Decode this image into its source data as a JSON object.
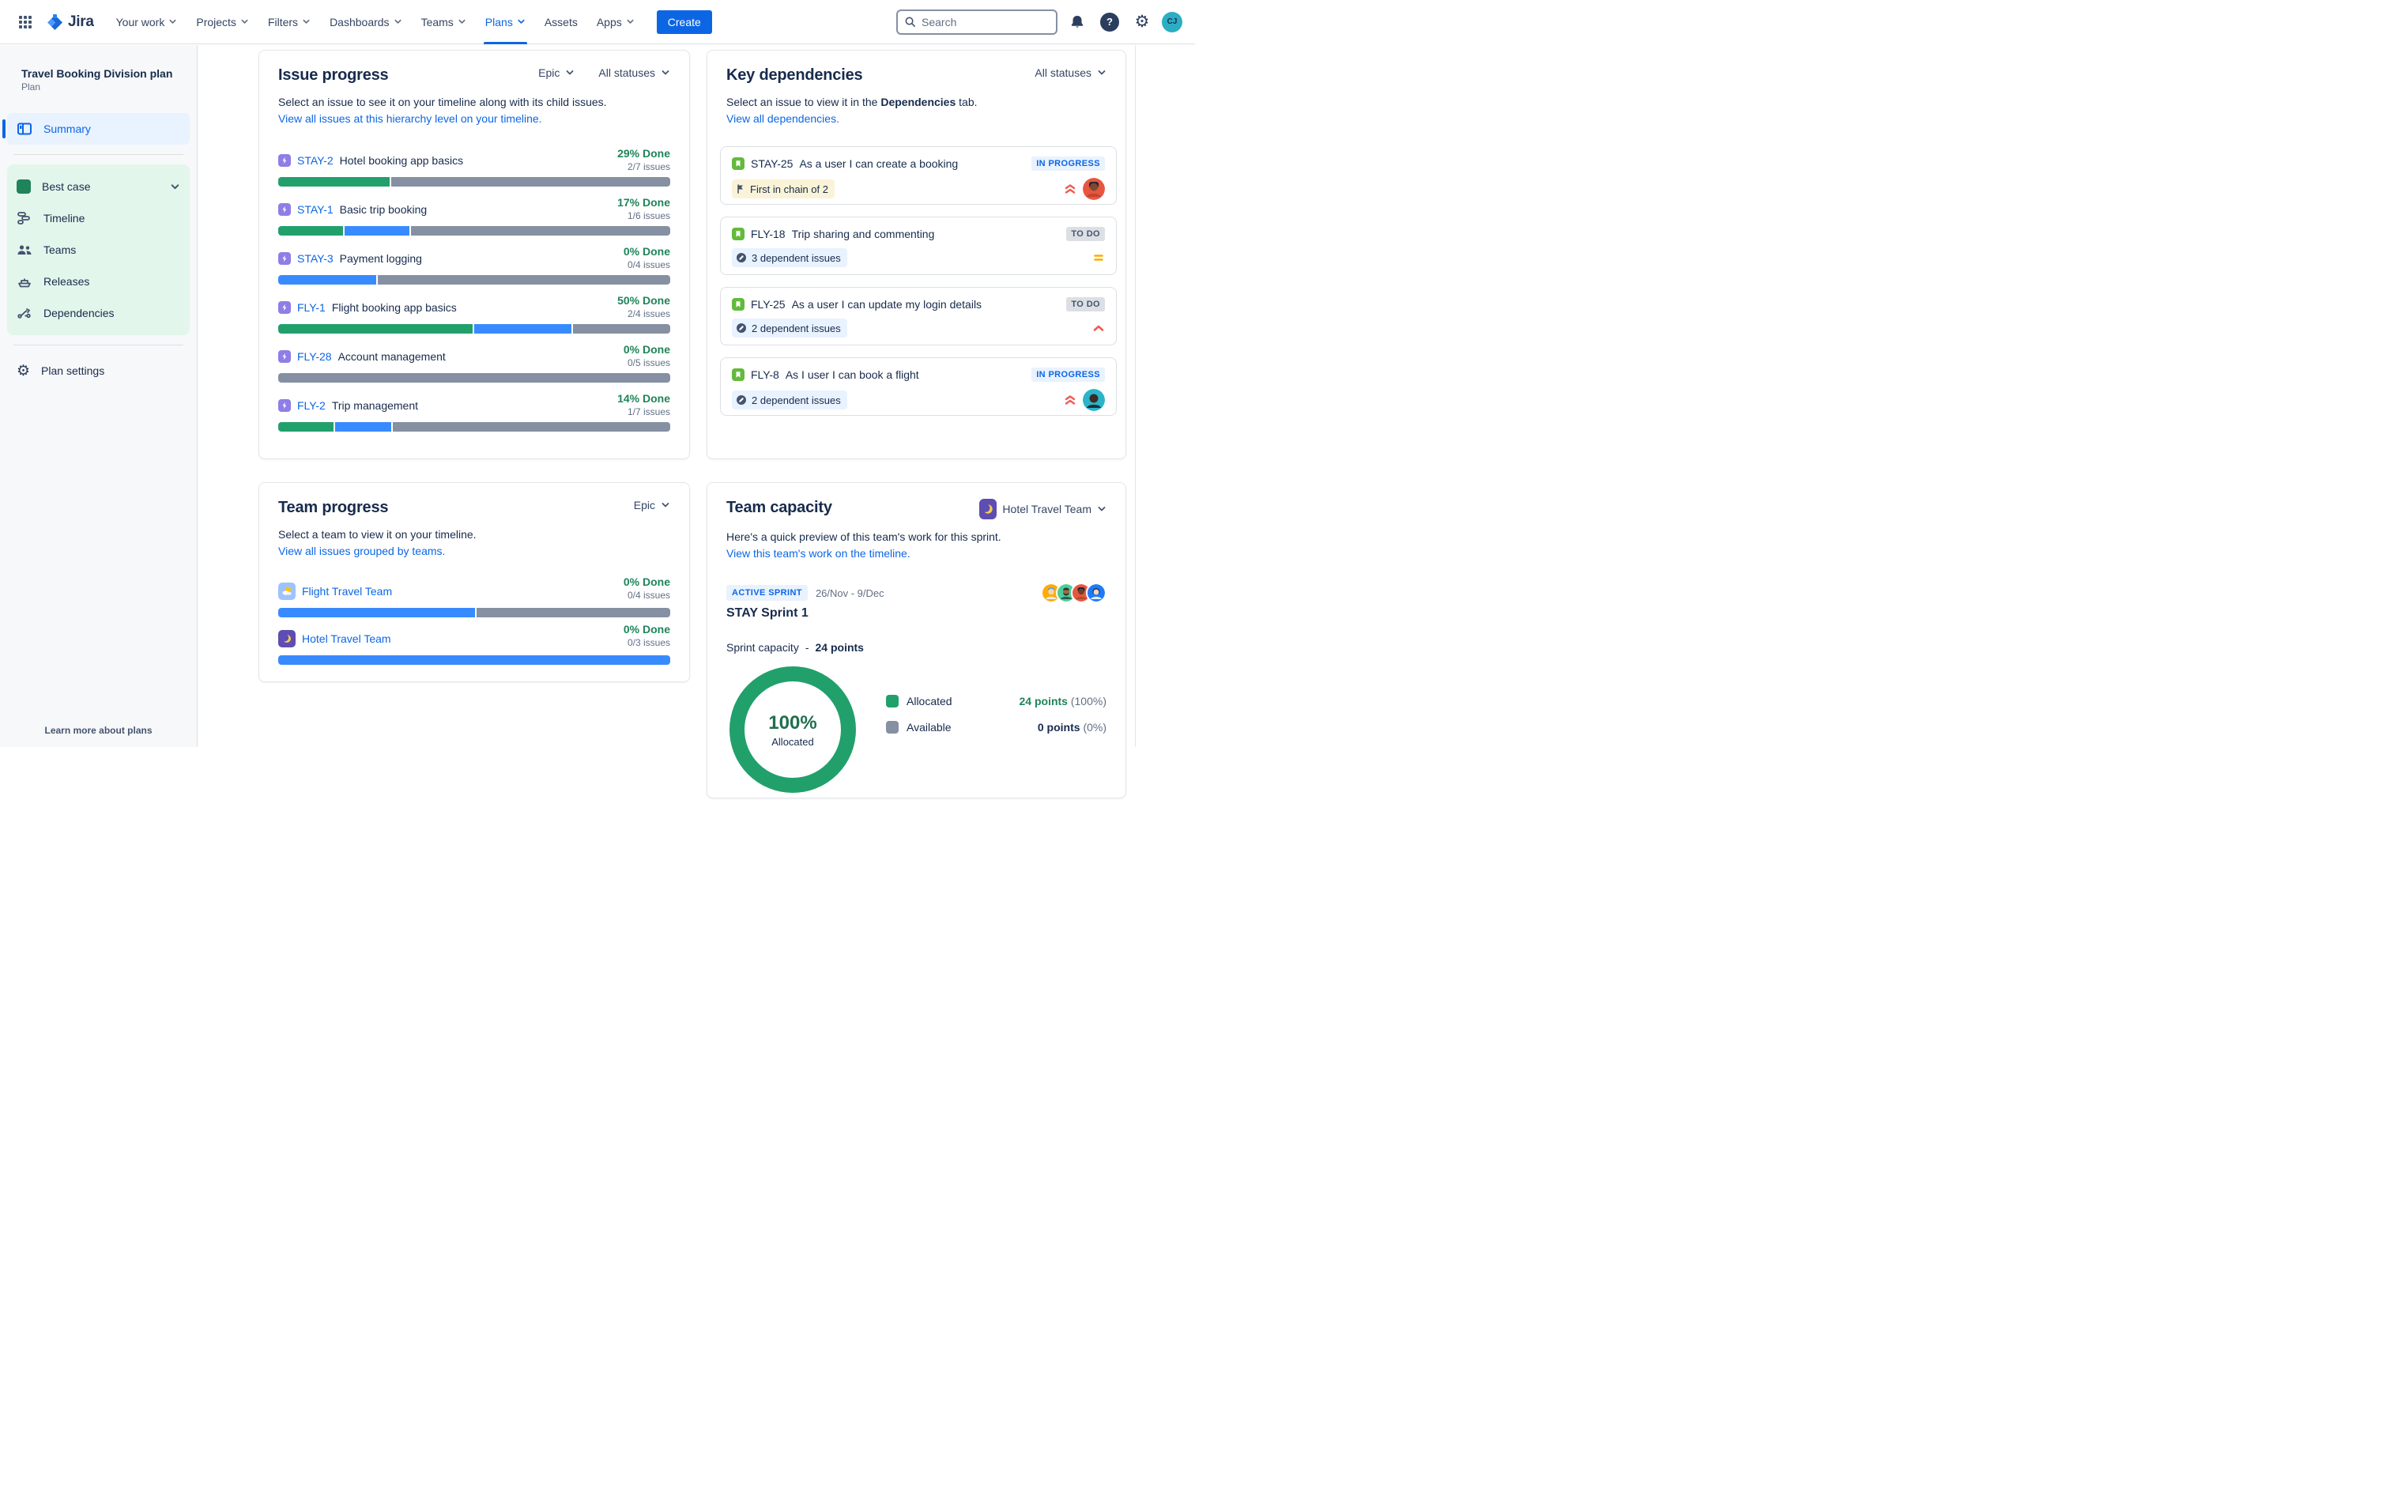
{
  "nav": {
    "logo_text": "Jira",
    "items": [
      {
        "label": "Your work",
        "chevron": true
      },
      {
        "label": "Projects",
        "chevron": true
      },
      {
        "label": "Filters",
        "chevron": true
      },
      {
        "label": "Dashboards",
        "chevron": true
      },
      {
        "label": "Teams",
        "chevron": true
      },
      {
        "label": "Plans",
        "chevron": true
      },
      {
        "label": "Assets",
        "chevron": false
      },
      {
        "label": "Apps",
        "chevron": true
      }
    ],
    "active_item": "Plans",
    "create_label": "Create",
    "search_placeholder": "Search",
    "help_glyph": "?",
    "gear_glyph": "⚙",
    "avatar_initials": "CJ"
  },
  "sidebar": {
    "plan_name": "Travel Booking Division plan",
    "plan_type": "Plan",
    "summary_label": "Summary",
    "scenario_label": "Best case",
    "items": [
      {
        "label": "Timeline"
      },
      {
        "label": "Teams"
      },
      {
        "label": "Releases"
      },
      {
        "label": "Dependencies"
      }
    ],
    "settings_label": "Plan settings",
    "learn_more": "Learn more about plans"
  },
  "issue_progress": {
    "title": "Issue progress",
    "filter_hierarchy": "Epic",
    "filter_status": "All statuses",
    "description": "Select an issue to see it on your timeline along with its child issues.",
    "link": "View all issues at this hierarchy level on your timeline.",
    "rows": [
      {
        "key": "STAY-2",
        "title": "Hotel booking app basics",
        "done_label": "29% Done",
        "issues_label": "2/7 issues",
        "segments": {
          "done": 28.6,
          "in_progress": 0,
          "todo": 71.4
        }
      },
      {
        "key": "STAY-1",
        "title": "Basic trip booking",
        "done_label": "17% Done",
        "issues_label": "1/6 issues",
        "segments": {
          "done": 16.7,
          "in_progress": 16.6,
          "todo": 66.7
        }
      },
      {
        "key": "STAY-3",
        "title": "Payment logging",
        "done_label": "0% Done",
        "issues_label": "0/4 issues",
        "segments": {
          "done": 0,
          "in_progress": 25,
          "todo": 75
        }
      },
      {
        "key": "FLY-1",
        "title": "Flight booking app basics",
        "done_label": "50% Done",
        "issues_label": "2/4 issues",
        "segments": {
          "done": 50,
          "in_progress": 25,
          "todo": 25
        }
      },
      {
        "key": "FLY-28",
        "title": "Account management",
        "done_label": "0% Done",
        "issues_label": "0/5 issues",
        "segments": {
          "done": 0,
          "in_progress": 0,
          "todo": 100
        }
      },
      {
        "key": "FLY-2",
        "title": "Trip management",
        "done_label": "14% Done",
        "issues_label": "1/7 issues",
        "segments": {
          "done": 14.3,
          "in_progress": 14.3,
          "todo": 71.4
        }
      }
    ]
  },
  "key_dependencies": {
    "title": "Key dependencies",
    "filter_status": "All statuses",
    "description_pre": "Select an issue to view it in the ",
    "description_bold": "Dependencies",
    "description_post": " tab.",
    "link": "View all dependencies.",
    "cards": [
      {
        "key": "STAY-25",
        "title": "As a user I can create a booking",
        "status": "IN PROGRESS",
        "status_type": "inprogress",
        "chip_text": "First in chain of 2",
        "chip_style": "yellow",
        "chip_icon": "flag",
        "priority": "highest",
        "has_avatar": true
      },
      {
        "key": "FLY-18",
        "title": "Trip sharing and commenting",
        "status": "TO DO",
        "status_type": "todo",
        "chip_text": "3 dependent issues",
        "chip_style": "blue",
        "chip_icon": "blocked",
        "priority": "medium",
        "has_avatar": false
      },
      {
        "key": "FLY-25",
        "title": "As a user I can update my login details",
        "status": "TO DO",
        "status_type": "todo",
        "chip_text": "2 dependent issues",
        "chip_style": "blue",
        "chip_icon": "blocked",
        "priority": "high",
        "has_avatar": false
      },
      {
        "key": "FLY-8",
        "title": "As I user I can book a flight",
        "status": "IN PROGRESS",
        "status_type": "inprogress",
        "chip_text": "2 dependent issues",
        "chip_style": "blue",
        "chip_icon": "blocked",
        "priority": "highest",
        "has_avatar": true
      }
    ]
  },
  "team_progress": {
    "title": "Team progress",
    "filter_hierarchy": "Epic",
    "description": "Select a team to view it on your timeline.",
    "link": "View all issues grouped by teams.",
    "rows": [
      {
        "team": "Flight Travel Team",
        "icon": "sun-cloud",
        "done_label": "0% Done",
        "issues_label": "0/4 issues",
        "segments": {
          "done": 0,
          "in_progress": 50.5,
          "todo": 49.5
        }
      },
      {
        "team": "Hotel Travel Team",
        "icon": "moon",
        "done_label": "0% Done",
        "issues_label": "0/3 issues",
        "segments": {
          "done": 0,
          "in_progress": 100,
          "todo": 0
        }
      }
    ]
  },
  "team_capacity": {
    "title": "Team capacity",
    "team_selector": "Hotel Travel Team",
    "description": "Here's a quick preview of this team's work for this sprint.",
    "link": "View this team's work on the timeline.",
    "sprint_badge": "ACTIVE SPRINT",
    "sprint_dates": "26/Nov - 9/Dec",
    "sprint_name": "STAY Sprint 1",
    "capacity_label": "Sprint capacity",
    "capacity_separator": "-",
    "capacity_value": "24 points",
    "donut": {
      "pct": "100%",
      "label": "Allocated"
    },
    "legend": [
      {
        "label": "Allocated",
        "value": "24 points",
        "pct": "(100%)",
        "color": "#22A06B"
      },
      {
        "label": "Available",
        "value": "0 points",
        "pct": "(0%)",
        "color": "#8590A2"
      }
    ]
  },
  "colors": {
    "accent_blue": "#0C66E4",
    "done_green": "#22A06B",
    "in_progress_blue": "#388BFF",
    "todo_gray": "#8590A2",
    "epic_purple": "#8F7EE7",
    "story_green": "#63BA3C",
    "priority_red": "#F15B50",
    "priority_orange": "#FFAB00",
    "selected_bg": "#E9F2FF",
    "scenario_bg": "#E3F6EB"
  }
}
